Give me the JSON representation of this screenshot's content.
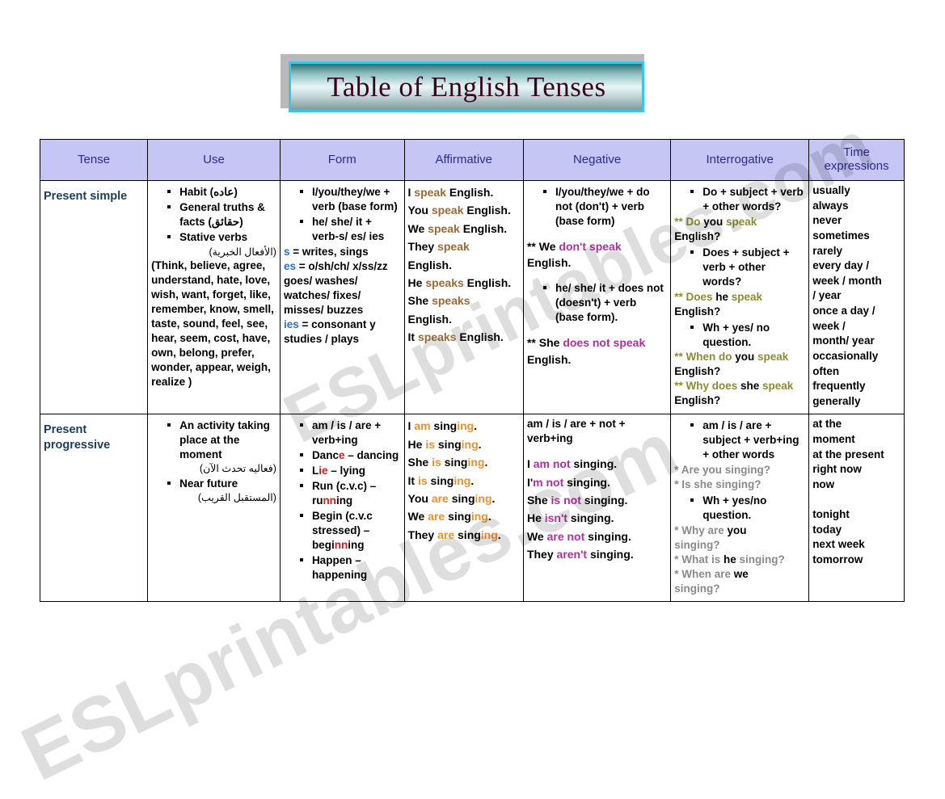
{
  "page": {
    "title": "Table of English Tenses",
    "watermark_1": "ESLprintables.com",
    "watermark_2": "ESLprintables.com"
  },
  "table": {
    "headers": [
      "Tense",
      "Use",
      "Form",
      "Affirmative",
      "Negative",
      "Interrogative",
      "Time expressions"
    ],
    "rows": [
      {
        "tense": "Present simple",
        "use": {
          "bullets": [
            "Habit (عاده)",
            "General  truths  &  facts (حقائق)",
            "Stative verbs"
          ],
          "arabic_note": "(الأفعال الخبرية)",
          "paragraph": "(Think, believe, agree, understand, hate, love, wish, want, forget, like, remember, know, smell, taste, sound, feel, see, hear, seem, cost, have, own, belong, prefer, wonder, appear, weigh, realize )"
        },
        "form": {
          "bullets": [
            "I/you/they/we + verb (base form)",
            "he/ she/ it + verb-s/ es/ ies"
          ],
          "rules": [
            {
              "key": "s",
              "rest": " = writes, sings"
            },
            {
              "key": "es",
              "rest": " = o/sh/ch/ x/ss/zz"
            },
            {
              "key": "",
              "rest": "goes/ washes/ watches/ fixes/ misses/ buzzes"
            },
            {
              "key": "ies",
              "rest": " = consonant y"
            },
            {
              "key": "",
              "rest": "studies / plays"
            }
          ]
        },
        "affirmative": [
          {
            "pre": "I ",
            "hl": "speak",
            "post": " English."
          },
          {
            "pre": "You ",
            "hl": "speak",
            "post": " English."
          },
          {
            "pre": "We ",
            "hl": "speak",
            "post": " English."
          },
          {
            "pre": "They ",
            "hl": "speak",
            "post": ""
          },
          {
            "pre": "English.",
            "hl": "",
            "post": ""
          },
          {
            "pre": "He ",
            "hl": "speaks",
            "post": " English."
          },
          {
            "pre": "She ",
            "hl": "speaks",
            "post": ""
          },
          {
            "pre": "English.",
            "hl": "",
            "post": ""
          },
          {
            "pre": "It ",
            "hl": "speaks",
            "post": " English."
          }
        ],
        "negative": {
          "bullets_1": [
            "I/you/they/we + do not (don't) + verb (base form)"
          ],
          "example_1": {
            "pre": "** We ",
            "hl": "don't speak",
            "post": ""
          },
          "example_1b": "English.",
          "bullets_2": [
            "he/ she/ it + does not (doesn't) + verb (base form)."
          ],
          "example_2": {
            "pre": "** She ",
            "hl": "does not speak",
            "post": ""
          },
          "example_2b": "English."
        },
        "interrogative": {
          "items": [
            {
              "kind": "bullet",
              "text": "Do + subject + verb + other words?"
            },
            {
              "kind": "example",
              "stars": "** ",
              "parts": [
                {
                  "t": "Do",
                  "c": "olive"
                },
                {
                  "t": " you ",
                  "c": "black"
                },
                {
                  "t": "speak",
                  "c": "olive"
                }
              ]
            },
            {
              "kind": "plain",
              "text": "English?"
            },
            {
              "kind": "bullet",
              "text": "Does + subject + verb + other words?"
            },
            {
              "kind": "example",
              "stars": "** ",
              "parts": [
                {
                  "t": "Does",
                  "c": "olive"
                },
                {
                  "t": " he ",
                  "c": "black"
                },
                {
                  "t": "speak",
                  "c": "olive"
                }
              ]
            },
            {
              "kind": "plain",
              "text": "English?"
            },
            {
              "kind": "bullet",
              "text": "Wh + yes/ no question."
            },
            {
              "kind": "example",
              "stars": "** ",
              "parts": [
                {
                  "t": "When do",
                  "c": "olive"
                },
                {
                  "t": " you ",
                  "c": "black"
                },
                {
                  "t": "speak",
                  "c": "olive"
                }
              ]
            },
            {
              "kind": "plain",
              "text": "English?"
            },
            {
              "kind": "example",
              "stars": "** ",
              "parts": [
                {
                  "t": "Why does",
                  "c": "olive"
                },
                {
                  "t": " she ",
                  "c": "black"
                },
                {
                  "t": "speak",
                  "c": "olive"
                }
              ]
            },
            {
              "kind": "plain",
              "text": "English?"
            }
          ]
        },
        "time_expressions": [
          "usually",
          "always",
          "never",
          "sometimes",
          "rarely",
          "every day /",
          "week / month",
          "/ year",
          "once a day /",
          "week /",
          "month/ year",
          "occasionally",
          "often",
          "frequently",
          "generally"
        ]
      },
      {
        "tense": "Present progressive",
        "use": {
          "bullets": [
            "An activity taking place at the moment"
          ],
          "arabic_note": "(فعاليه تحدث الآن)",
          "bullets_2": [
            "Near future"
          ],
          "arabic_note_2": "(المستقبل القريب)"
        },
        "form": {
          "bullets": [
            {
              "parts": [
                {
                  "t": "am / is / are + verb+ing",
                  "c": "black"
                }
              ]
            },
            {
              "parts": [
                {
                  "t": "Danc",
                  "c": "black"
                },
                {
                  "t": "e",
                  "c": "red"
                },
                {
                  "t": " – dancing",
                  "c": "black"
                }
              ]
            },
            {
              "parts": [
                {
                  "t": "L",
                  "c": "black"
                },
                {
                  "t": "ie",
                  "c": "red"
                },
                {
                  "t": " – lying",
                  "c": "black"
                }
              ]
            },
            {
              "parts": [
                {
                  "t": "Run (c.v.c) – ru",
                  "c": "black"
                },
                {
                  "t": "nn",
                  "c": "red"
                },
                {
                  "t": "ing",
                  "c": "black"
                }
              ]
            },
            {
              "parts": [
                {
                  "t": "Begin (c.v.c stressed) – begi",
                  "c": "black"
                },
                {
                  "t": "nn",
                  "c": "red"
                },
                {
                  "t": "ing",
                  "c": "black"
                }
              ]
            },
            {
              "parts": [
                {
                  "t": "Happen – happening",
                  "c": "black"
                }
              ]
            }
          ]
        },
        "affirmative": [
          {
            "pre": "I ",
            "hl": "am",
            "mid": " sing",
            "hl2": "ing",
            "post": "."
          },
          {
            "pre": "He ",
            "hl": "is",
            "mid": " sing",
            "hl2": "ing",
            "post": "."
          },
          {
            "pre": "She ",
            "hl": "is",
            "mid": " sing",
            "hl2": "ing",
            "post": "."
          },
          {
            "pre": "It ",
            "hl": "is",
            "mid": " sing",
            "hl2": "ing",
            "post": "."
          },
          {
            "pre": "You ",
            "hl": "are",
            "mid": " sing",
            "hl2": "ing",
            "post": "."
          },
          {
            "pre": "We ",
            "hl": "are",
            "mid": " sing",
            "hl2": "ing",
            "post": "."
          },
          {
            "pre": "They ",
            "hl": "are",
            "mid": " sing",
            "hl2": "ing",
            "post": "."
          }
        ],
        "negative": {
          "form_text": "am / is / are + not + verb+ing",
          "examples": [
            {
              "pre": "I ",
              "hl": "am not",
              "post": " singing."
            },
            {
              "pre": "I'm ",
              "hl": "not",
              "post": " singing.",
              "alt_pre": "I'",
              "alt_hl": "m not"
            },
            {
              "pre": "She ",
              "hl": "is not",
              "post": " singing."
            },
            {
              "pre": "He ",
              "hl": "isn't",
              "post": " singing."
            },
            {
              "pre": "We ",
              "hl": "are not",
              "post": " singing."
            },
            {
              "pre": "They ",
              "hl": "aren't",
              "post": " singing."
            }
          ]
        },
        "interrogative": {
          "items": [
            {
              "kind": "bullet",
              "text": "am / is / are + subject + verb+ing + other words"
            },
            {
              "kind": "example",
              "stars": "* ",
              "parts": [
                {
                  "t": "Are you singing?",
                  "c": "gray"
                }
              ]
            },
            {
              "kind": "example",
              "stars": "* ",
              "parts": [
                {
                  "t": "Is she singing?",
                  "c": "gray"
                }
              ]
            },
            {
              "kind": "bullet",
              "text": "Wh + yes/no question."
            },
            {
              "kind": "example",
              "stars": "* ",
              "parts": [
                {
                  "t": "Why are ",
                  "c": "gray"
                },
                {
                  "t": "you",
                  "c": "black"
                }
              ]
            },
            {
              "kind": "plaingray",
              "text": "singing?"
            },
            {
              "kind": "example",
              "stars": "* ",
              "parts": [
                {
                  "t": "What is ",
                  "c": "gray"
                },
                {
                  "t": "he",
                  "c": "black"
                },
                {
                  "t": " singing?",
                  "c": "gray"
                }
              ]
            },
            {
              "kind": "example",
              "stars": "* ",
              "parts": [
                {
                  "t": "When are ",
                  "c": "gray"
                },
                {
                  "t": "we",
                  "c": "black"
                }
              ]
            },
            {
              "kind": "plaingray",
              "text": "singing?"
            }
          ]
        },
        "time_expressions": [
          "at the",
          "moment",
          "at the present",
          "right now",
          "now",
          "",
          "tonight",
          "today",
          "next week",
          "tomorrow"
        ]
      }
    ]
  },
  "colors": {
    "header_bg": "#c5c6f4",
    "header_text": "#2b2b8f",
    "tense_label": "#1c3c5a",
    "title_text": "#3d0323",
    "banner_border": "#37c8e8",
    "accent_brown": "#9a6a35",
    "accent_blue": "#2b6fc4",
    "accent_magenta": "#b02fa0",
    "accent_olive": "#8c8b35",
    "accent_orange": "#e8912f",
    "accent_red": "#cf2020",
    "accent_gray": "#8a8a8a"
  }
}
